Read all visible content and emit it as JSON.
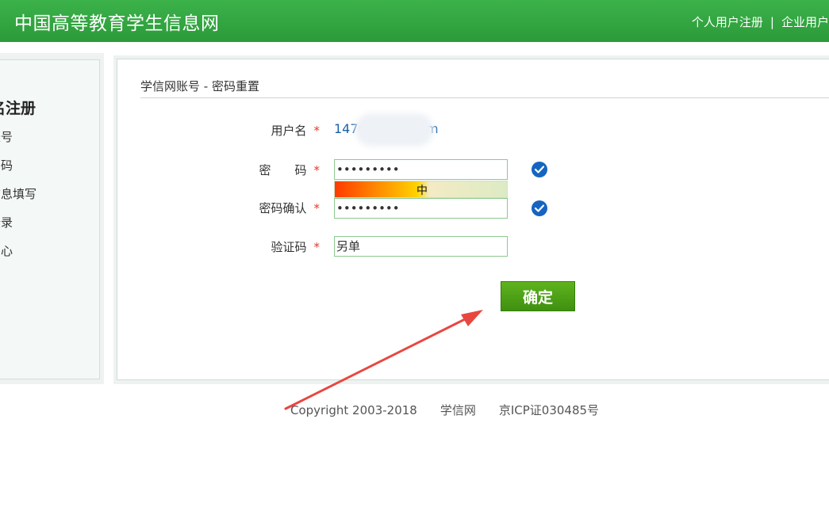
{
  "header": {
    "site_title": "中国高等教育学生信息网",
    "links": [
      "个人用户注册",
      "企业用户"
    ],
    "separator": "|"
  },
  "sidebar": {
    "heading": "名注册",
    "items": [
      "账号",
      "密码",
      "信息填写",
      "登录",
      "中心"
    ]
  },
  "form": {
    "title": "学信网账号 - 密码重置",
    "required_mark": "*",
    "username": {
      "label": "用户名",
      "value": "1476      @163.com"
    },
    "password": {
      "label": "密　　码",
      "value": "•••••••••"
    },
    "strength": {
      "label": "中",
      "level": 0.5
    },
    "password_confirm": {
      "label": "密码确认",
      "value": "•••••••••"
    },
    "captcha": {
      "label": "验证码",
      "value": "另单"
    },
    "submit_label": "确定"
  },
  "footer": {
    "copyright": "Copyright 2003-2018",
    "site": "学信网",
    "icp": "京ICP证030485号"
  },
  "colors": {
    "header_green": "#2b9a39",
    "button_green": "#4fa316",
    "link_blue": "#1a5fa8",
    "required_red": "#e23a2c",
    "check_blue": "#1565c0",
    "annotation_arrow": "#e8473f"
  },
  "icons": {
    "valid_check": "check-circle-icon",
    "annotation": "arrow-annotation-icon"
  }
}
